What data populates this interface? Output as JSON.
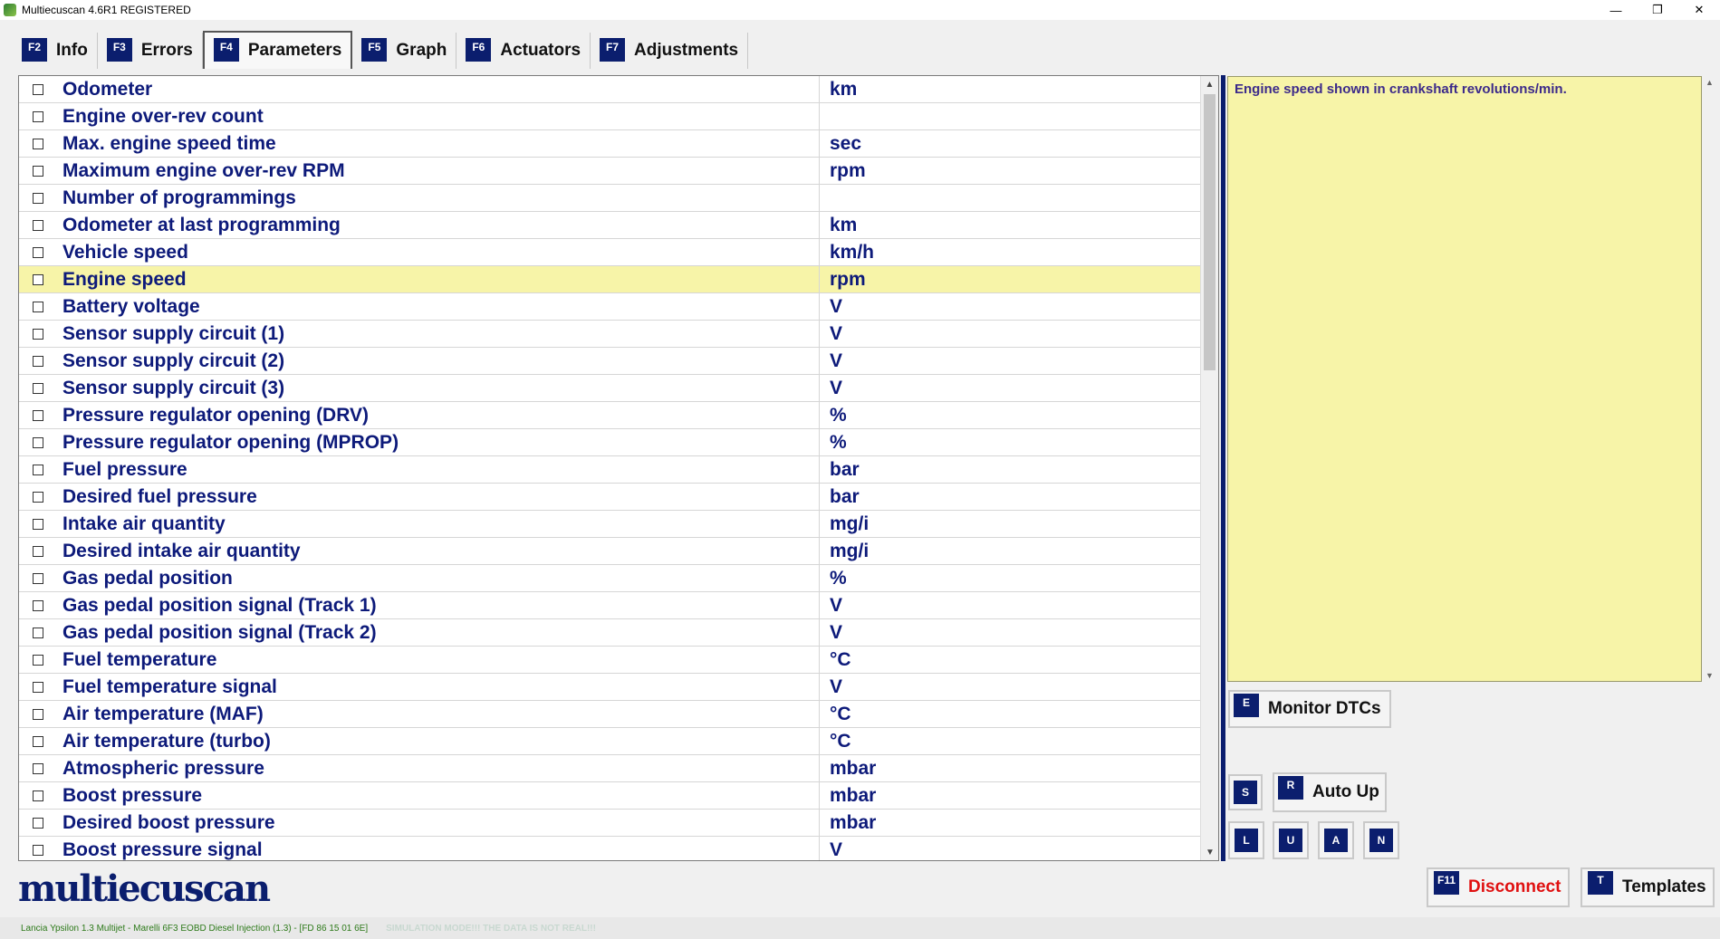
{
  "window": {
    "title": "Multiecuscan 4.6R1 REGISTERED",
    "controls": [
      "—",
      "❐",
      "✕"
    ]
  },
  "tabs": [
    {
      "key": "F2",
      "label": "Info",
      "active": false
    },
    {
      "key": "F3",
      "label": "Errors",
      "active": false
    },
    {
      "key": "F4",
      "label": "Parameters",
      "active": true
    },
    {
      "key": "F5",
      "label": "Graph",
      "active": false
    },
    {
      "key": "F6",
      "label": "Actuators",
      "active": false
    },
    {
      "key": "F7",
      "label": "Adjustments",
      "active": false
    }
  ],
  "parameters": [
    {
      "name": "Odometer",
      "unit": "km"
    },
    {
      "name": "Engine over-rev count",
      "unit": ""
    },
    {
      "name": "Max. engine speed time",
      "unit": "sec"
    },
    {
      "name": "Maximum engine over-rev RPM",
      "unit": "rpm"
    },
    {
      "name": "Number of programmings",
      "unit": ""
    },
    {
      "name": "Odometer at last programming",
      "unit": "km"
    },
    {
      "name": "Vehicle speed",
      "unit": "km/h"
    },
    {
      "name": "Engine speed",
      "unit": "rpm",
      "selected": true
    },
    {
      "name": "Battery voltage",
      "unit": "V"
    },
    {
      "name": "Sensor supply circuit (1)",
      "unit": "V"
    },
    {
      "name": "Sensor supply circuit (2)",
      "unit": "V"
    },
    {
      "name": "Sensor supply circuit (3)",
      "unit": "V"
    },
    {
      "name": "Pressure regulator opening (DRV)",
      "unit": "%"
    },
    {
      "name": "Pressure regulator opening (MPROP)",
      "unit": "%"
    },
    {
      "name": "Fuel pressure",
      "unit": "bar"
    },
    {
      "name": "Desired fuel pressure",
      "unit": "bar"
    },
    {
      "name": "Intake air quantity",
      "unit": "mg/i"
    },
    {
      "name": "Desired intake air quantity",
      "unit": "mg/i"
    },
    {
      "name": "Gas pedal position",
      "unit": "%"
    },
    {
      "name": "Gas pedal position signal (Track 1)",
      "unit": "V"
    },
    {
      "name": "Gas pedal position signal (Track 2)",
      "unit": "V"
    },
    {
      "name": "Fuel temperature",
      "unit": "°C"
    },
    {
      "name": "Fuel temperature signal",
      "unit": "V"
    },
    {
      "name": "Air temperature (MAF)",
      "unit": "°C"
    },
    {
      "name": "Air temperature (turbo)",
      "unit": "°C"
    },
    {
      "name": "Atmospheric pressure",
      "unit": "mbar"
    },
    {
      "name": "Boost pressure",
      "unit": "mbar"
    },
    {
      "name": "Desired boost pressure",
      "unit": "mbar"
    },
    {
      "name": "Boost pressure signal",
      "unit": "V"
    }
  ],
  "description": {
    "text": "Engine speed shown in crankshaft revolutions/min."
  },
  "buttons": {
    "monitor_dtcs": {
      "key": "E",
      "label": "Monitor DTCs"
    },
    "s": {
      "key": "S"
    },
    "auto_up": {
      "key": "R",
      "label": "Auto Up"
    },
    "l": {
      "key": "L"
    },
    "u": {
      "key": "U"
    },
    "a": {
      "key": "A"
    },
    "n": {
      "key": "N"
    },
    "disconnect": {
      "key": "F11",
      "label": "Disconnect",
      "color": "#e01010"
    },
    "templates": {
      "key": "T",
      "label": "Templates"
    }
  },
  "logo": "multiecuscan",
  "status": {
    "vehicle": "Lancia Ypsilon 1.3 Multijet - Marelli 6F3 EOBD Diesel Injection (1.3) - [FD 86 15 01 6E]",
    "simulation": "SIMULATION MODE!!! THE DATA IS NOT REAL!!!"
  },
  "colors": {
    "accent": "#0b1e6e",
    "highlight": "#f7f4a8",
    "text": "#0d1a7a"
  }
}
